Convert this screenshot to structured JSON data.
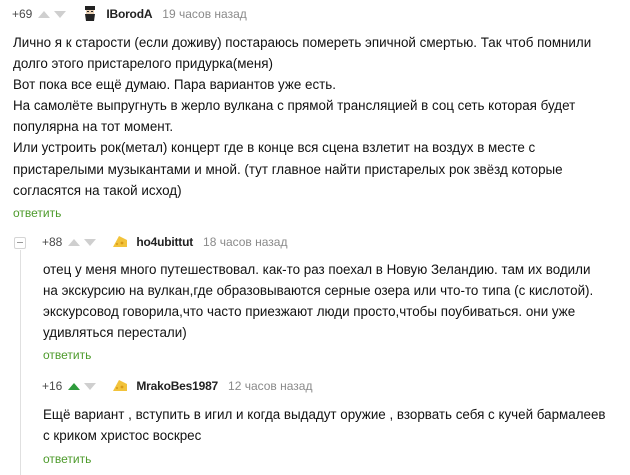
{
  "comments": [
    {
      "rating": "+69",
      "username": "IBorodA",
      "time": "19 часов назад",
      "avatar": "bearded-man-avatar-icon",
      "text_lines": [
        "Лично я к старости (если доживу) постараюсь помереть эпичной смертью. Так чтоб помнили",
        "долго этого пристарелого придурка(меня)",
        "Вот пока все ещё думаю. Пара вариантов уже есть.",
        "На самолёте выпругнуть в жерло вулкана с прямой трансляцией в соц сеть которая будет",
        "популярна на тот момент.",
        "Или устроить рок(метал)  концерт где в конце вся сцена взлетит на воздух в месте с",
        "пристарелыми музыкантами и мной. (тут главное найти пристарелых рок звёзд которые",
        "согласятся на такой исход)"
      ],
      "reply": "ответить"
    },
    {
      "rating": "+88",
      "username": "ho4ubittut",
      "time": "18 часов назад",
      "avatar": "cheese-avatar-icon",
      "text_lines": [
        "отец у меня много путешествовал. как-то раз поехал в Новую Зеландию. там их водили",
        "на экскурсию на вулкан,где образовываются серные озера или что-то типа (с кислотой).",
        "экскурсовод говорила,что часто приезжают люди просто,чтобы поубиваться. они уже",
        "удивляться перестали)"
      ],
      "reply": "ответить"
    },
    {
      "rating": "+16",
      "username": "MrakoBes1987",
      "time": "12 часов назад",
      "avatar": "cheese-avatar-icon",
      "text_lines": [
        "Ещё вариант , вступить в игил и когда выдадут оружие , взорвать себя с кучей бармалеев",
        "с криком христос воскрес"
      ],
      "reply": "ответить"
    }
  ],
  "colors": {
    "reply_link": "#4c9a2a",
    "upvote_active": "#2e9b3b",
    "arrow_inactive": "#cfcfcf",
    "timestamp": "#8a8a8a"
  }
}
